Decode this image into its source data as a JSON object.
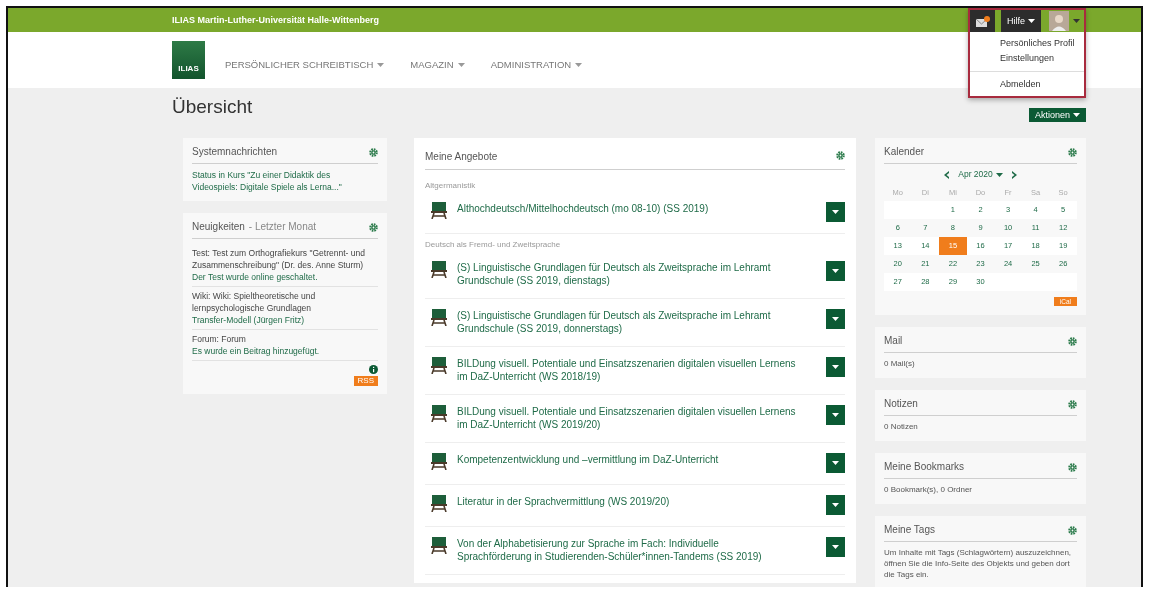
{
  "top_bar": {
    "title": "ILIAS Martin-Luther-Universität Halle-Wittenberg"
  },
  "user_menu": {
    "help": "Hilfe",
    "expanded": true,
    "groups": [
      [
        "Persönliches Profil",
        "Einstellungen"
      ],
      [
        "Abmelden"
      ]
    ]
  },
  "navigation": {
    "logo": "ILIAS",
    "items": [
      "PERSÖNLICHER SCHREIBTISCH",
      "MAGAZIN",
      "ADMINISTRATION"
    ]
  },
  "page": {
    "title": "Übersicht",
    "actions": "Aktionen"
  },
  "left_blocks": [
    {
      "title": "Systemnachrichten",
      "entries": [
        {
          "link": "Status in Kurs \"Zu einer Didaktik des Videospiels: Digitale Spiele als Lerna...\""
        }
      ]
    },
    {
      "title": "Neuigkeiten",
      "subtitle": "- Letzter Monat",
      "entries": [
        {
          "label": "Test: Test zum Orthografiekurs \"Getrennt- und Zusammenschreibung\" (Dr. des. Anne Sturm)",
          "link": "Der Test wurde online geschaltet."
        },
        {
          "label": "Wiki: Wiki: Spieltheoretische und lernpsychologische Grundlagen",
          "link": "Transfer-Modell (Jürgen Fritz)"
        },
        {
          "label": "Forum: Forum",
          "link": "Es wurde ein Beitrag hinzugefügt."
        }
      ],
      "rss": "RSS"
    }
  ],
  "offers": {
    "title": "Meine Angebote",
    "groups": [
      {
        "heading": "Altgermanistik",
        "items": [
          "Althochdeutsch/Mittelhochdeutsch (mo 08-10) (SS 2019)"
        ]
      },
      {
        "heading": "Deutsch als Fremd- und Zweitsprache",
        "items": [
          "(S) Linguistische Grundlagen für Deutsch als Zweitsprache im Lehramt Grundschule (SS 2019, dienstags)",
          "(S) Linguistische Grundlagen für Deutsch als Zweitsprache im Lehramt Grundschule (SS 2019, donnerstags)",
          "BILDung visuell. Potentiale und Einsatzszenarien digitalen visuellen Lernens im DaZ-Unterricht (WS 2018/19)",
          "BILDung visuell. Potentiale und Einsatzszenarien digitalen visuellen Lernens im DaZ-Unterricht (WS 2019/20)",
          "Kompetenzentwicklung und –vermittlung im DaZ-Unterricht",
          "Literatur in der Sprachvermittlung (WS 2019/20)",
          "Von der Alphabetisierung zur Sprache im Fach: Individuelle Sprachförderung in Studierenden-Schüler*innen-Tandems (SS 2019)"
        ]
      }
    ]
  },
  "calendar": {
    "title": "Kalender",
    "month": "Apr 2020",
    "weekdays": [
      "Mo",
      "Di",
      "Mi",
      "Do",
      "Fr",
      "Sa",
      "So"
    ],
    "weeks": [
      [
        {
          "day": "1",
          "selected": false
        },
        {
          "day": "2",
          "selected": false
        },
        {
          "day": "3",
          "selected": false
        },
        {
          "day": "4",
          "selected": false
        },
        {
          "day": "5",
          "selected": false
        }
      ],
      [
        {
          "day": "6",
          "selected": false
        },
        {
          "day": "7",
          "selected": false
        },
        {
          "day": "8",
          "selected": false
        },
        {
          "day": "9",
          "selected": false
        },
        {
          "day": "10",
          "selected": false
        },
        {
          "day": "11",
          "selected": false
        },
        {
          "day": "12",
          "selected": false
        }
      ],
      [
        {
          "day": "13",
          "selected": false
        },
        {
          "day": "14",
          "selected": false
        },
        {
          "day": "15",
          "selected": true
        },
        {
          "day": "16",
          "selected": false
        },
        {
          "day": "17",
          "selected": false
        },
        {
          "day": "18",
          "selected": false
        },
        {
          "day": "19",
          "selected": false
        }
      ],
      [
        {
          "day": "20",
          "selected": false
        },
        {
          "day": "21",
          "selected": false
        },
        {
          "day": "22",
          "selected": false
        },
        {
          "day": "23",
          "selected": false
        },
        {
          "day": "24",
          "selected": false
        },
        {
          "day": "25",
          "selected": false
        },
        {
          "day": "26",
          "selected": false
        }
      ],
      [
        {
          "day": "27",
          "selected": false
        },
        {
          "day": "28",
          "selected": false
        },
        {
          "day": "29",
          "selected": false
        },
        {
          "day": "30",
          "selected": false
        }
      ]
    ],
    "ical": "iCal"
  },
  "right_blocks": [
    {
      "title": "Mail",
      "text": "0 Mail(s)"
    },
    {
      "title": "Notizen",
      "text": "0 Notizen"
    },
    {
      "title": "Meine Bookmarks",
      "text": "0 Bookmark(s), 0 Ordner"
    },
    {
      "title": "Meine Tags",
      "text": "Um Inhalte mit Tags (Schlagwörtern) auszuzeichnen, öffnen Sie die Info-Seite des Objekts und geben dort die Tags ein."
    }
  ]
}
